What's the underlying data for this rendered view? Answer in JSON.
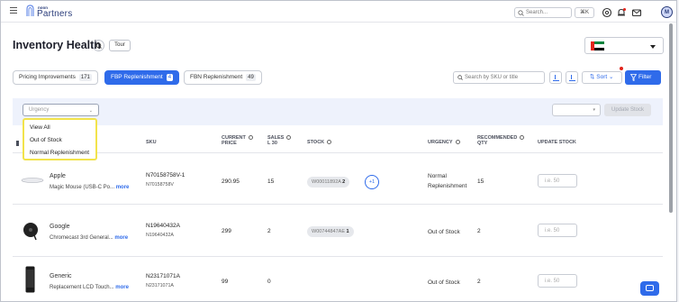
{
  "brand": {
    "small": "noon",
    "big": "Partners"
  },
  "topbar": {
    "search_placeholder": "Search...",
    "shortcut": "⌘K",
    "avatar": "M"
  },
  "page": {
    "title": "Inventory Health",
    "tour_label": "Tour"
  },
  "tabs": [
    {
      "label": "Pricing Improvements",
      "count": "171"
    },
    {
      "label": "FBP Replenishment",
      "count": "4",
      "active": true
    },
    {
      "label": "FBN Replenishment",
      "count": "49"
    }
  ],
  "toolbar": {
    "search_placeholder": "Search by SKU or title",
    "sort_label": "Sort",
    "filter_label": "Filter"
  },
  "filters": {
    "urgency_placeholder": "Urgency",
    "update_stock_label": "Update Stock"
  },
  "urgency_options": [
    "View All",
    "Out of Stock",
    "Normal Replenishment"
  ],
  "table": {
    "headers": {
      "sku": "SKU",
      "price_line1": "CURRENT",
      "price_line2": "PRICE",
      "sales_line1": "SALES",
      "sales_line2": "L 30",
      "stock": "STOCK",
      "urgency": "URGENCY",
      "rec_line1": "RECOMMENDED",
      "rec_line2": "QTY",
      "update": "UPDATE STOCK"
    },
    "rows": [
      {
        "brand": "Apple",
        "product": "Magic Mouse (USB-C Po...",
        "more": "more",
        "sku": "N70158758V-1",
        "sku_sub": "N70158758V",
        "price": "290.95",
        "sales": "15",
        "stock_code": "W00011892A",
        "stock_qty": "2",
        "extra": "+1",
        "urgency": "Normal Replenishment",
        "rec_qty": "15",
        "qty_placeholder": "i.e. 50"
      },
      {
        "brand": "Google",
        "product": "Chromecast 3rd General...",
        "more": "more",
        "sku": "N19640432A",
        "sku_sub": "N19640432A",
        "price": "299",
        "sales": "2",
        "stock_code": "W00744847AE",
        "stock_qty": "1",
        "urgency": "Out of Stock",
        "rec_qty": "2",
        "qty_placeholder": "i.e. 50"
      },
      {
        "brand": "Generic",
        "product": "Replacement LCD Touch...",
        "more": "more",
        "sku": "N23171071A",
        "sku_sub": "N23171071A",
        "price": "99",
        "sales": "0",
        "urgency": "Out of Stock",
        "rec_qty": "2",
        "qty_placeholder": "i.e. 50"
      }
    ]
  },
  "colors": {
    "accent": "#2f6bea",
    "highlight": "#f2e34b",
    "panel": "#eef2fc"
  }
}
